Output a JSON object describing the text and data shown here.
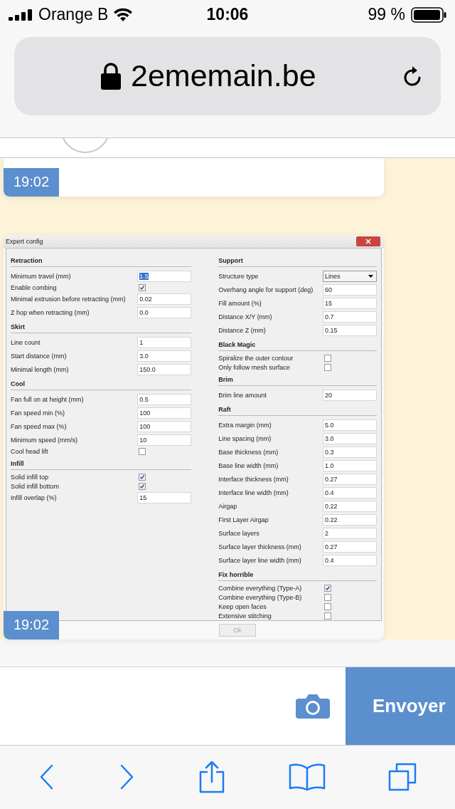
{
  "status_bar": {
    "carrier": "Orange B",
    "time": "10:06",
    "battery": "99 %"
  },
  "address_bar": {
    "url": "2ememain.be"
  },
  "messages": [
    {
      "kind": "image_tail",
      "time": "19:02"
    },
    {
      "kind": "dialog",
      "time": "19:02",
      "dialog": {
        "title": "Expert config",
        "columns": [
          {
            "sections": [
              {
                "title": "Retraction",
                "rows": [
                  {
                    "kind": "field",
                    "label": "Minimum travel (mm)",
                    "value": "1.5",
                    "value_selected": true
                  },
                  {
                    "kind": "check",
                    "label": "Enable combing",
                    "checked": true
                  },
                  {
                    "kind": "field",
                    "label": "Minimal extrusion before retracting (mm)",
                    "value": "0.02",
                    "value_selected": false
                  },
                  {
                    "kind": "field",
                    "label": "Z hop when retracting (mm)",
                    "value": "0.0",
                    "value_selected": false
                  }
                ]
              },
              {
                "title": "Skirt",
                "rows": [
                  {
                    "kind": "field",
                    "label": "Line count",
                    "value": "1",
                    "value_selected": false
                  },
                  {
                    "kind": "field",
                    "label": "Start distance (mm)",
                    "value": "3.0",
                    "value_selected": false
                  },
                  {
                    "kind": "field",
                    "label": "Minimal length (mm)",
                    "value": "150.0",
                    "value_selected": false
                  }
                ]
              },
              {
                "title": "Cool",
                "rows": [
                  {
                    "kind": "field",
                    "label": "Fan full on at height (mm)",
                    "value": "0.5",
                    "value_selected": false
                  },
                  {
                    "kind": "field",
                    "label": "Fan speed min (%)",
                    "value": "100",
                    "value_selected": false
                  },
                  {
                    "kind": "field",
                    "label": "Fan speed max (%)",
                    "value": "100",
                    "value_selected": false
                  },
                  {
                    "kind": "field",
                    "label": "Minimum speed (mm/s)",
                    "value": "10",
                    "value_selected": false
                  },
                  {
                    "kind": "check",
                    "label": "Cool head lift",
                    "checked": false
                  }
                ]
              },
              {
                "title": "Infill",
                "rows": [
                  {
                    "kind": "check",
                    "label": "Solid infill top",
                    "checked": true
                  },
                  {
                    "kind": "check",
                    "label": "Solid infill bottom",
                    "checked": true
                  },
                  {
                    "kind": "field",
                    "label": "Infill overlap (%)",
                    "value": "15",
                    "value_selected": false
                  }
                ]
              }
            ]
          },
          {
            "sections": [
              {
                "title": "Support",
                "rows": [
                  {
                    "kind": "select",
                    "label": "Structure type",
                    "value": "Lines"
                  },
                  {
                    "kind": "field",
                    "label": "Overhang angle for support (deg)",
                    "value": "60",
                    "value_selected": false
                  },
                  {
                    "kind": "field",
                    "label": "Fill amount (%)",
                    "value": "15",
                    "value_selected": false
                  },
                  {
                    "kind": "field",
                    "label": "Distance X/Y (mm)",
                    "value": "0.7",
                    "value_selected": false
                  },
                  {
                    "kind": "field",
                    "label": "Distance Z (mm)",
                    "value": "0.15",
                    "value_selected": false
                  }
                ]
              },
              {
                "title": "Black Magic",
                "rows": [
                  {
                    "kind": "check",
                    "label": "Spiralize the outer contour",
                    "checked": false
                  },
                  {
                    "kind": "check",
                    "label": "Only follow mesh surface",
                    "checked": false
                  }
                ]
              },
              {
                "title": "Brim",
                "rows": [
                  {
                    "kind": "field",
                    "label": "Brim line amount",
                    "value": "20",
                    "value_selected": false
                  }
                ]
              },
              {
                "title": "Raft",
                "rows": [
                  {
                    "kind": "field",
                    "label": "Extra margin (mm)",
                    "value": "5.0",
                    "value_selected": false
                  },
                  {
                    "kind": "field",
                    "label": "Line spacing (mm)",
                    "value": "3.0",
                    "value_selected": false
                  },
                  {
                    "kind": "field",
                    "label": "Base thickness (mm)",
                    "value": "0.3",
                    "value_selected": false
                  },
                  {
                    "kind": "field",
                    "label": "Base line width (mm)",
                    "value": "1.0",
                    "value_selected": false
                  },
                  {
                    "kind": "field",
                    "label": "Interface thickness (mm)",
                    "value": "0.27",
                    "value_selected": false
                  },
                  {
                    "kind": "field",
                    "label": "Interface line width (mm)",
                    "value": "0.4",
                    "value_selected": false
                  },
                  {
                    "kind": "field",
                    "label": "Airgap",
                    "value": "0.22",
                    "value_selected": false
                  },
                  {
                    "kind": "field",
                    "label": "First Layer Airgap",
                    "value": "0.22",
                    "value_selected": false
                  },
                  {
                    "kind": "field",
                    "label": "Surface layers",
                    "value": "2",
                    "value_selected": false
                  },
                  {
                    "kind": "field",
                    "label": "Surface layer thickness (mm)",
                    "value": "0.27",
                    "value_selected": false
                  },
                  {
                    "kind": "field",
                    "label": "Surface layer line width (mm)",
                    "value": "0.4",
                    "value_selected": false
                  }
                ]
              },
              {
                "title": "Fix horrible",
                "rows": [
                  {
                    "kind": "check",
                    "label": "Combine everything (Type-A)",
                    "checked": true
                  },
                  {
                    "kind": "check",
                    "label": "Combine everything (Type-B)",
                    "checked": false
                  },
                  {
                    "kind": "check",
                    "label": "Keep open faces",
                    "checked": false
                  },
                  {
                    "kind": "check",
                    "label": "Extensive stitching",
                    "checked": false
                  }
                ]
              }
            ]
          }
        ],
        "ok_button": {
          "label": "Ok",
          "disabled": true
        }
      }
    }
  ],
  "composer": {
    "send_label": "Envoyer"
  }
}
